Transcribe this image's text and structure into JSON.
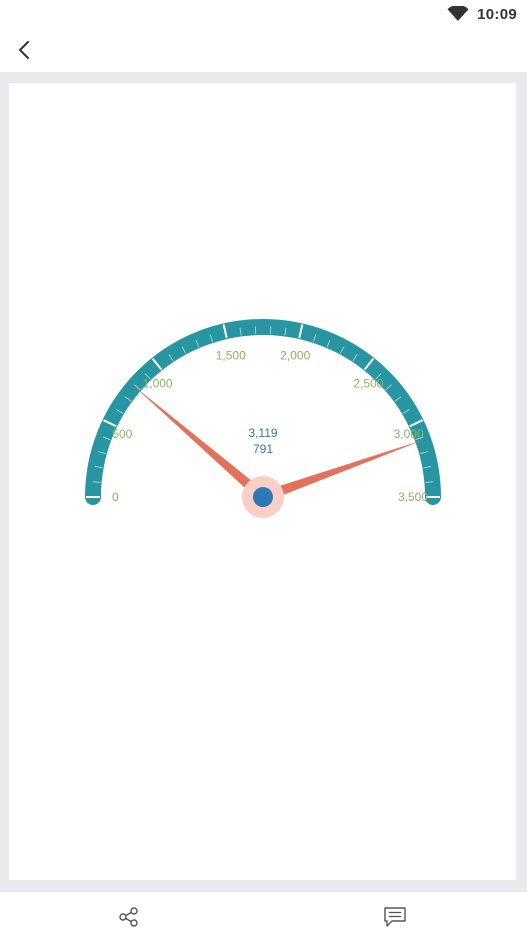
{
  "status_bar": {
    "time": "10:09",
    "wifi_icon": "wifi-icon"
  },
  "app_bar": {
    "back_icon": "back-arrow-icon"
  },
  "gauge": {
    "min": 0,
    "max": 3500,
    "tick_labels": [
      "0",
      "500",
      "1,000",
      "1,500",
      "2,000",
      "2,500",
      "3,000",
      "3,500"
    ],
    "tick_values": [
      0,
      500,
      1000,
      1500,
      2000,
      2500,
      3000,
      3500
    ],
    "needle_values": [
      791,
      3119
    ],
    "readout": {
      "primary": "3,119",
      "secondary": "791"
    },
    "colors": {
      "band": "#2896a2",
      "needle": "#e2725b",
      "pivot": "#2f78b6",
      "pivot_halo": "#f9cfc6",
      "label": "#8db365",
      "readout": "#2f78b6"
    }
  },
  "bottom_bar": {
    "share_icon": "share-icon",
    "comment_icon": "comment-icon"
  }
}
